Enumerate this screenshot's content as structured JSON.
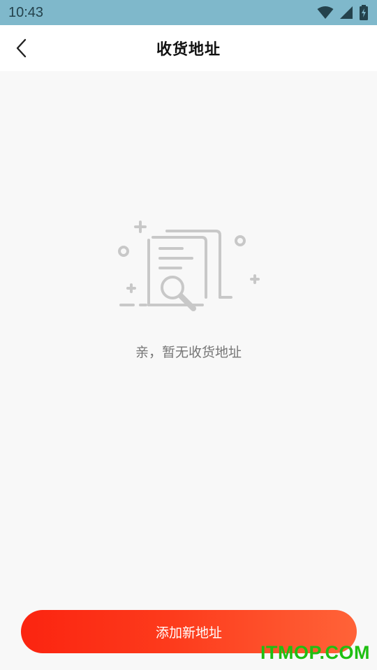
{
  "status_bar": {
    "time": "10:43",
    "icons": [
      "wifi-icon",
      "cellular-signal-icon",
      "battery-charging-icon"
    ]
  },
  "header": {
    "back_icon": "chevron-left-icon",
    "title": "收货地址"
  },
  "empty_state": {
    "illustration": "document-search-illustration",
    "message": "亲，暂无收货地址"
  },
  "footer": {
    "add_button_label": "添加新地址"
  },
  "watermark": {
    "text": "ITMOP.COM"
  },
  "colors": {
    "status_bar": "#7fb8cb",
    "accent_start": "#fb2410",
    "accent_end": "#ff6338",
    "watermark": "#1fbf12"
  }
}
